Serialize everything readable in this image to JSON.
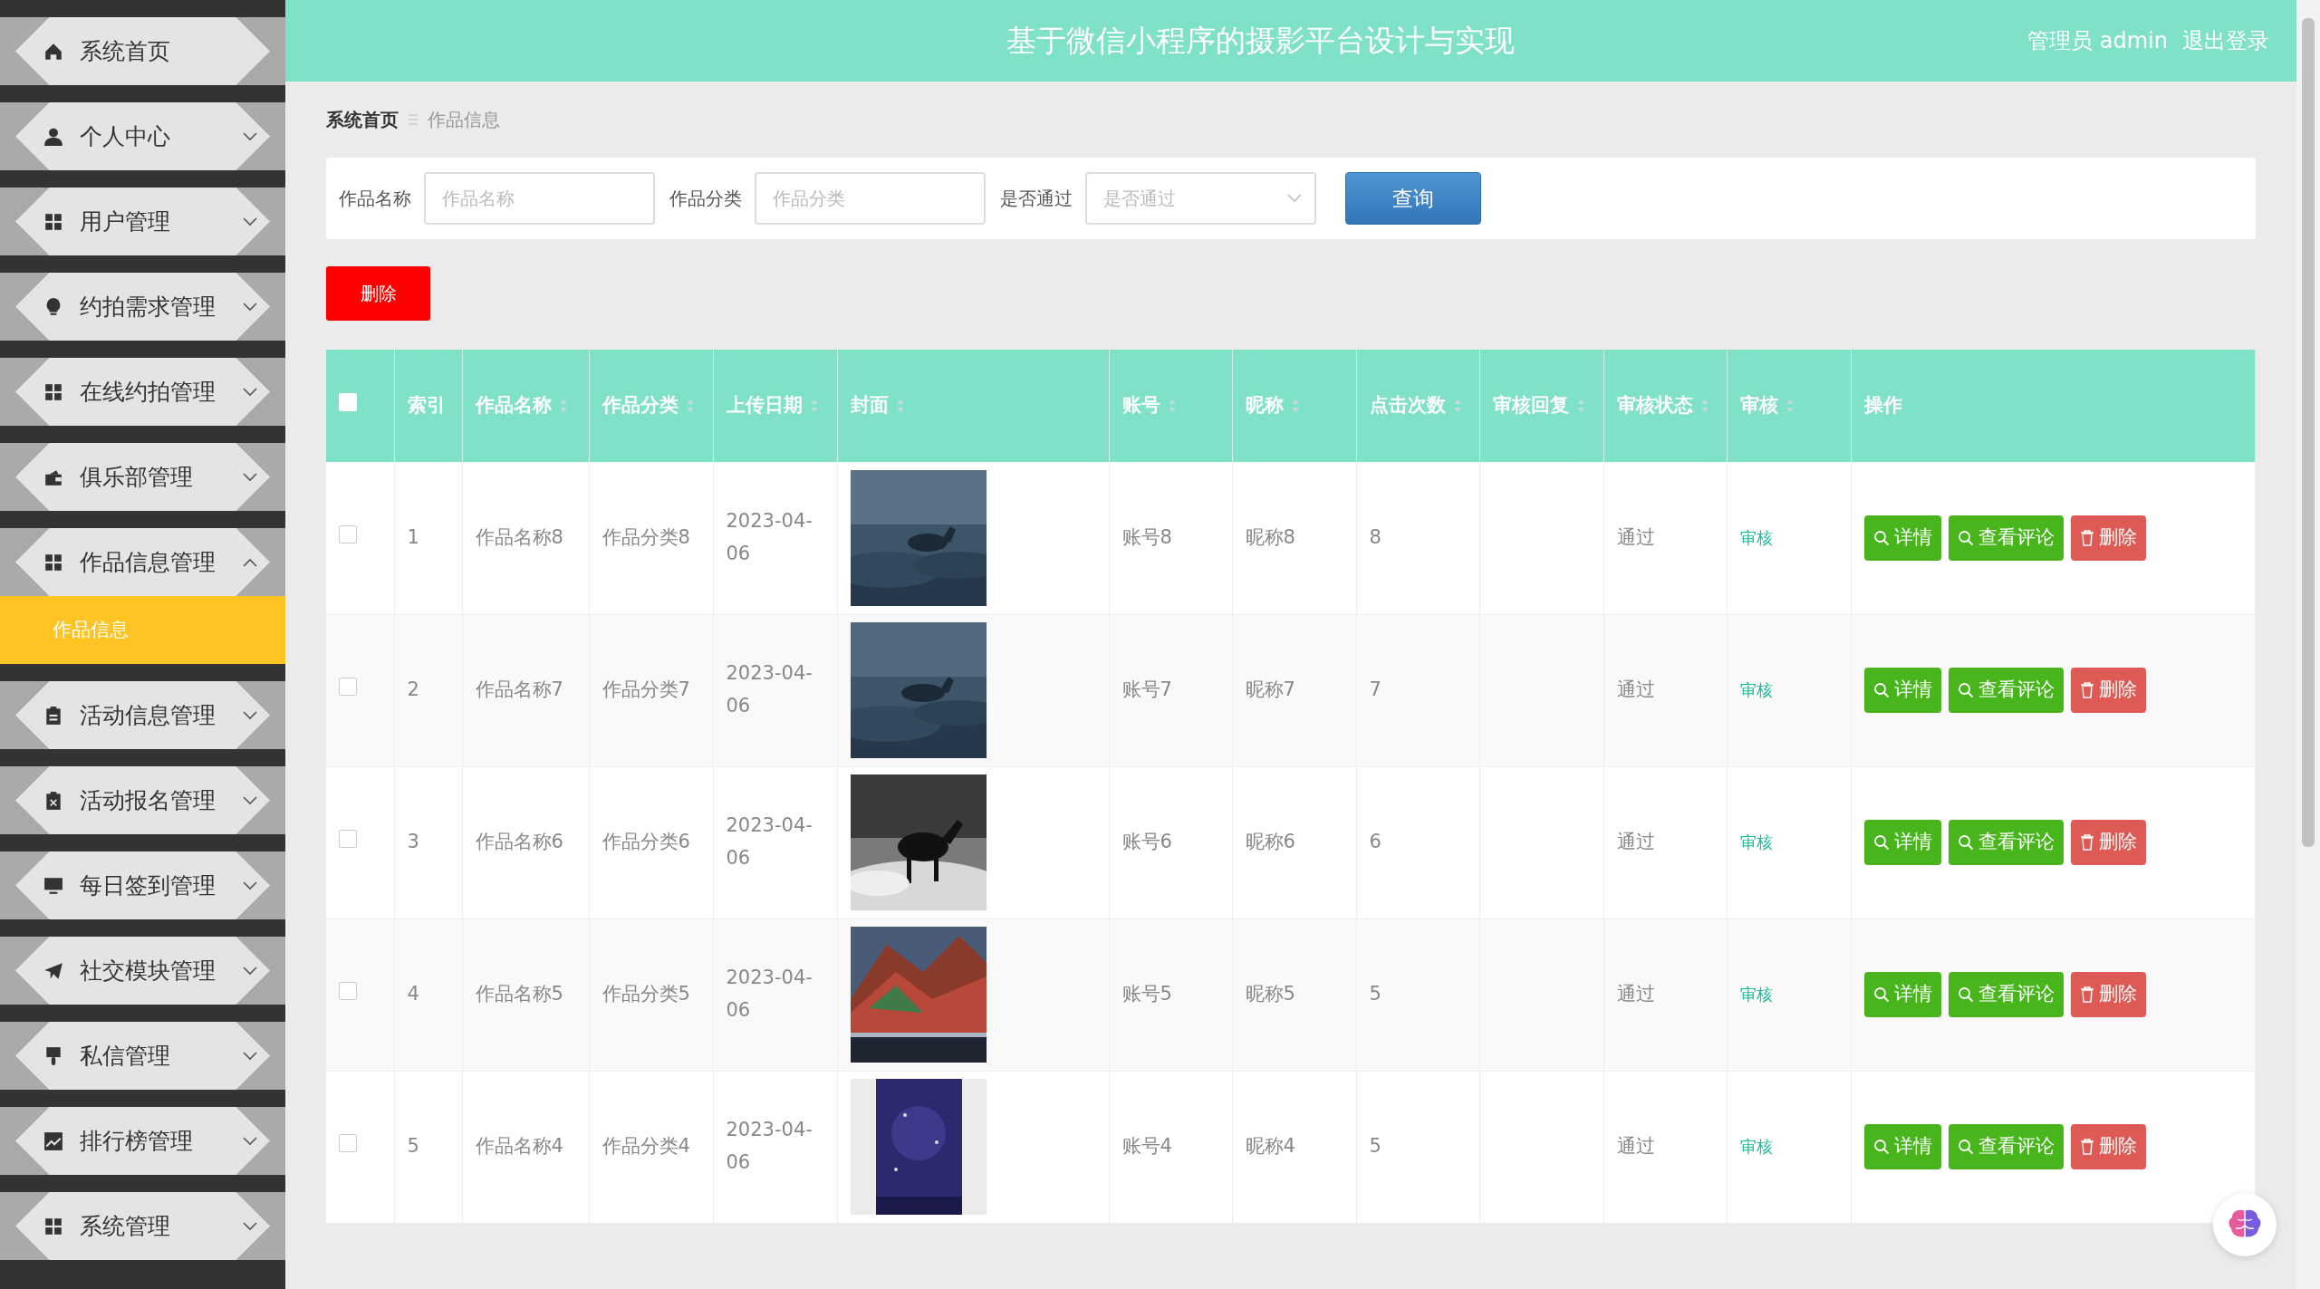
{
  "sidebar": {
    "items": [
      {
        "label": "系统首页",
        "expandable": false
      },
      {
        "label": "个人中心",
        "expandable": true,
        "expanded": false
      },
      {
        "label": "用户管理",
        "expandable": true,
        "expanded": false
      },
      {
        "label": "约拍需求管理",
        "expandable": true,
        "expanded": false
      },
      {
        "label": "在线约拍管理",
        "expandable": true,
        "expanded": false
      },
      {
        "label": "俱乐部管理",
        "expandable": true,
        "expanded": false
      },
      {
        "label": "作品信息管理",
        "expandable": true,
        "expanded": true,
        "children": [
          {
            "label": "作品信息",
            "selected": true
          }
        ]
      },
      {
        "label": "活动信息管理",
        "expandable": true,
        "expanded": false
      },
      {
        "label": "活动报名管理",
        "expandable": true,
        "expanded": false
      },
      {
        "label": "每日签到管理",
        "expandable": true,
        "expanded": false
      },
      {
        "label": "社交模块管理",
        "expandable": true,
        "expanded": false
      },
      {
        "label": "私信管理",
        "expandable": true,
        "expanded": false
      },
      {
        "label": "排行榜管理",
        "expandable": true,
        "expanded": false
      },
      {
        "label": "系统管理",
        "expandable": true,
        "expanded": false
      }
    ]
  },
  "header": {
    "title": "基于微信小程序的摄影平台设计与实现",
    "user": "管理员 admin",
    "logout": "退出登录"
  },
  "breadcrumb": [
    "系统首页",
    "作品信息"
  ],
  "search": {
    "fields": [
      {
        "kind": "text",
        "label": "作品名称",
        "placeholder": "作品名称"
      },
      {
        "kind": "text",
        "label": "作品分类",
        "placeholder": "作品分类"
      },
      {
        "kind": "select",
        "label": "是否通过",
        "placeholder": "是否通过"
      }
    ],
    "button": "查询"
  },
  "delete_button": "删除",
  "table": {
    "select_all": {
      "checked": false
    },
    "columns": [
      {
        "label": "索引",
        "sortable": false
      },
      {
        "label": "作品名称",
        "sortable": true
      },
      {
        "label": "作品分类",
        "sortable": true
      },
      {
        "label": "上传日期",
        "sortable": true
      },
      {
        "label": "封面",
        "sortable": true
      },
      {
        "label": "账号",
        "sortable": true
      },
      {
        "label": "昵称",
        "sortable": true
      },
      {
        "label": "点击次数",
        "sortable": true
      },
      {
        "label": "审核回复",
        "sortable": true
      },
      {
        "label": "审核状态",
        "sortable": true
      },
      {
        "label": "审核",
        "sortable": true
      },
      {
        "label": "操作",
        "sortable": false
      }
    ],
    "rows": [
      {
        "checked": false,
        "index": "1",
        "name": "作品名称8",
        "category": "作品分类8",
        "date": "2023-04-06",
        "account": "账号8",
        "nickname": "昵称8",
        "clicks": "8",
        "status": "通过",
        "audit": "审核",
        "actions": [
          "详情",
          "查看评论",
          "删除"
        ]
      },
      {
        "checked": false,
        "index": "2",
        "name": "作品名称7",
        "category": "作品分类7",
        "date": "2023-04-06",
        "account": "账号7",
        "nickname": "昵称7",
        "clicks": "7",
        "status": "通过",
        "audit": "审核",
        "actions": [
          "详情",
          "查看评论",
          "删除"
        ]
      },
      {
        "checked": false,
        "index": "3",
        "name": "作品名称6",
        "category": "作品分类6",
        "date": "2023-04-06",
        "account": "账号6",
        "nickname": "昵称6",
        "clicks": "6",
        "status": "通过",
        "audit": "审核",
        "actions": [
          "详情",
          "查看评论",
          "删除"
        ]
      },
      {
        "checked": false,
        "index": "4",
        "name": "作品名称5",
        "category": "作品分类5",
        "date": "2023-04-06",
        "account": "账号5",
        "nickname": "昵称5",
        "clicks": "5",
        "status": "通过",
        "audit": "审核",
        "actions": [
          "详情",
          "查看评论",
          "删除"
        ]
      },
      {
        "checked": false,
        "index": "5",
        "name": "作品名称4",
        "category": "作品分类4",
        "date": "2023-04-06",
        "account": "账号4",
        "nickname": "昵称4",
        "clicks": "5",
        "status": "通过",
        "audit": "审核",
        "actions": [
          "详情",
          "查看评论",
          "删除"
        ]
      }
    ]
  }
}
